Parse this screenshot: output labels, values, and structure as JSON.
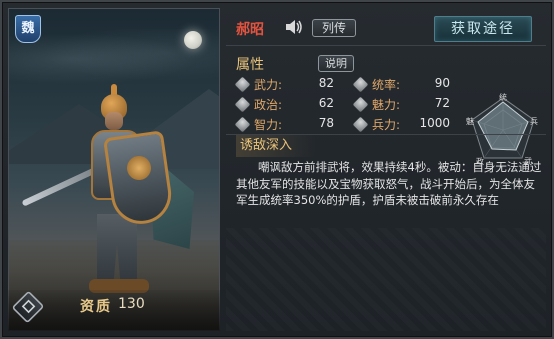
{
  "portrait": {
    "badge_text": "魏",
    "quality_label": "资质",
    "quality_value": "130"
  },
  "header": {
    "hero_name": "郝昭",
    "bio_button": "列传",
    "acquire_button": "获取途径"
  },
  "attributes": {
    "title": "属性",
    "explain_button": "说明",
    "stats": [
      {
        "label": "武力:",
        "value": "82",
        "icon": "sword-icon"
      },
      {
        "label": "统率:",
        "value": "90",
        "icon": "banner-icon"
      },
      {
        "label": "政治:",
        "value": "62",
        "icon": "scroll-icon"
      },
      {
        "label": "魅力:",
        "value": "72",
        "icon": "charm-icon"
      },
      {
        "label": "智力:",
        "value": "78",
        "icon": "book-icon"
      },
      {
        "label": "兵力:",
        "value": "1000",
        "icon": "troops-icon"
      }
    ],
    "radar_labels": [
      "统",
      "魅",
      "兵",
      "政",
      "武"
    ]
  },
  "skill": {
    "title": "诱敌深入",
    "description": "嘲讽敌方前排武将，效果持续4秒。被动：自身无法通过其他友军的技能以及宝物获取怒气，战斗开始后，为全体友军生成统率350%的护盾，护盾未被击破前永久存在"
  },
  "colors": {
    "name": "#e2533f",
    "gold": "#e7c27a",
    "stat_label": "#e0a86a",
    "accent": "#4f7e8a"
  }
}
